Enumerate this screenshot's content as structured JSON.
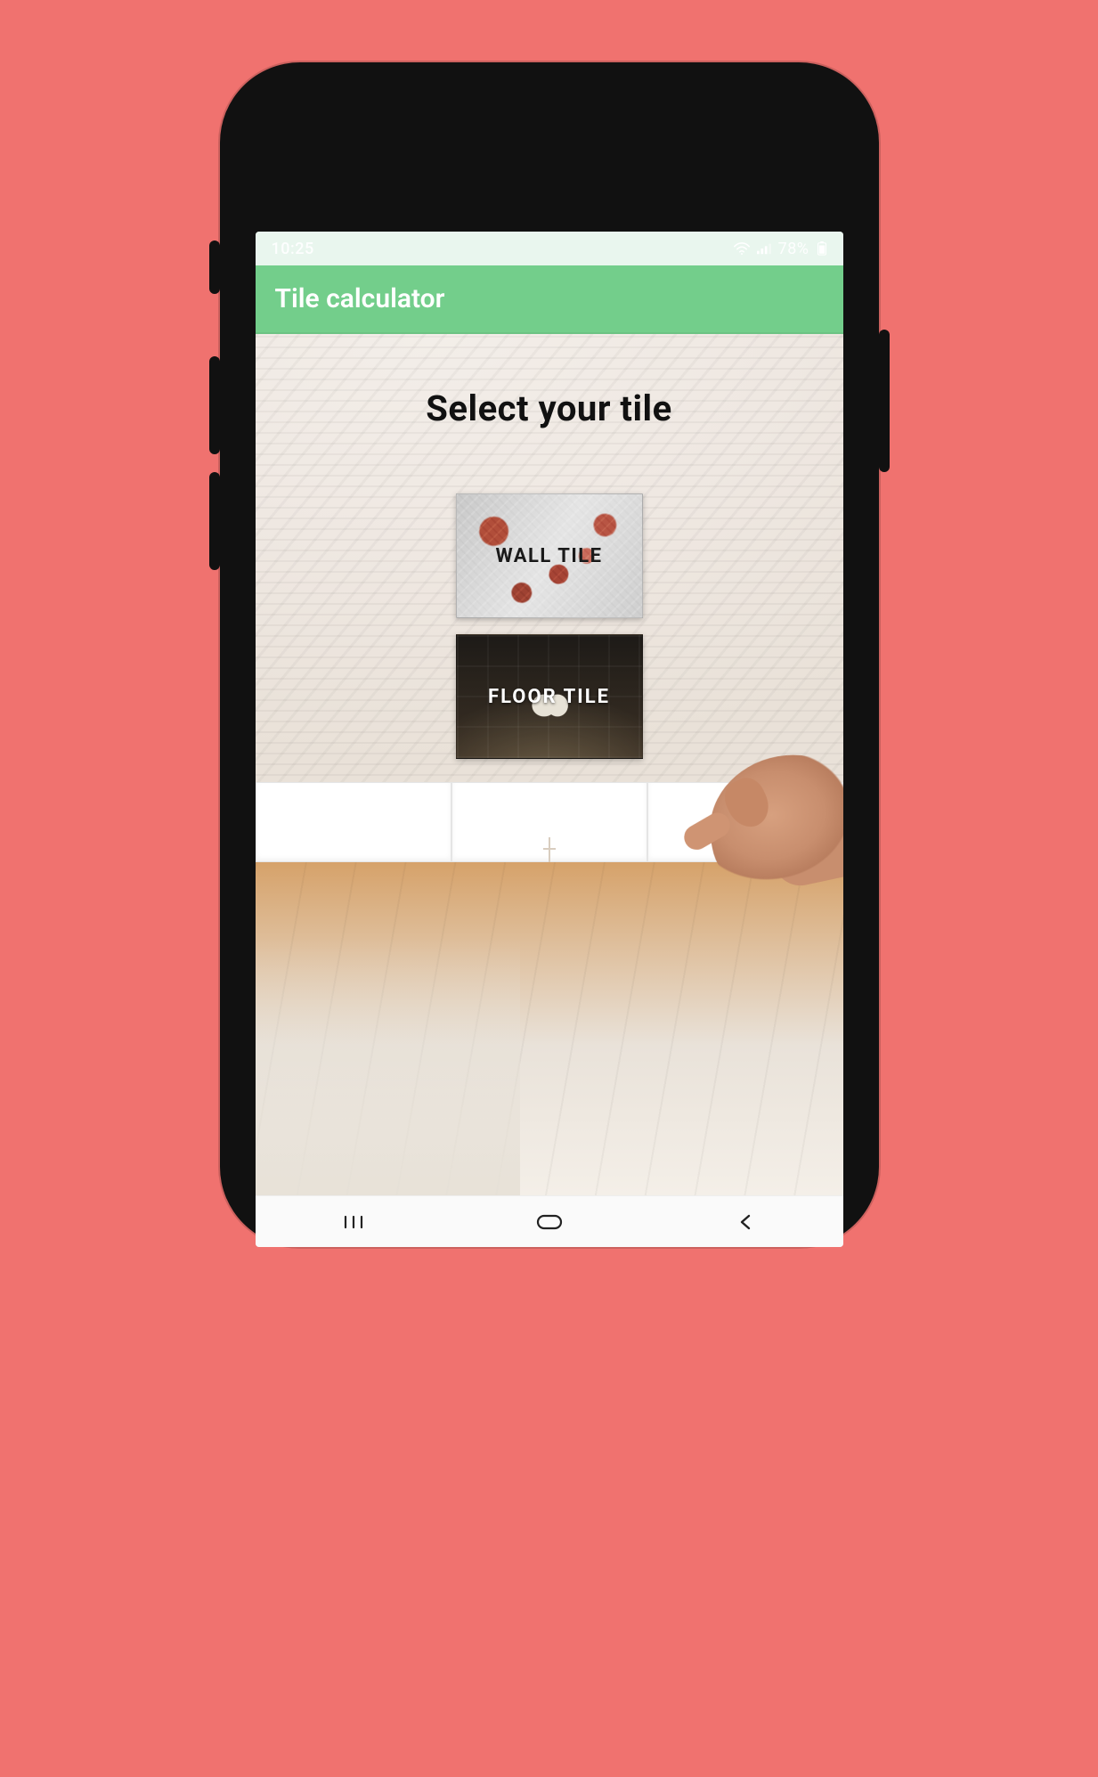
{
  "status_bar": {
    "time": "10:25",
    "battery_text": "78%"
  },
  "header": {
    "title": "Tile calculator"
  },
  "main": {
    "heading": "Select your tile",
    "options": {
      "wall": {
        "label": "WALL TILE"
      },
      "floor": {
        "label": "FLOOR TILE"
      }
    }
  },
  "colors": {
    "page_bg": "#f0726f",
    "header_bg": "#73ce8b"
  }
}
